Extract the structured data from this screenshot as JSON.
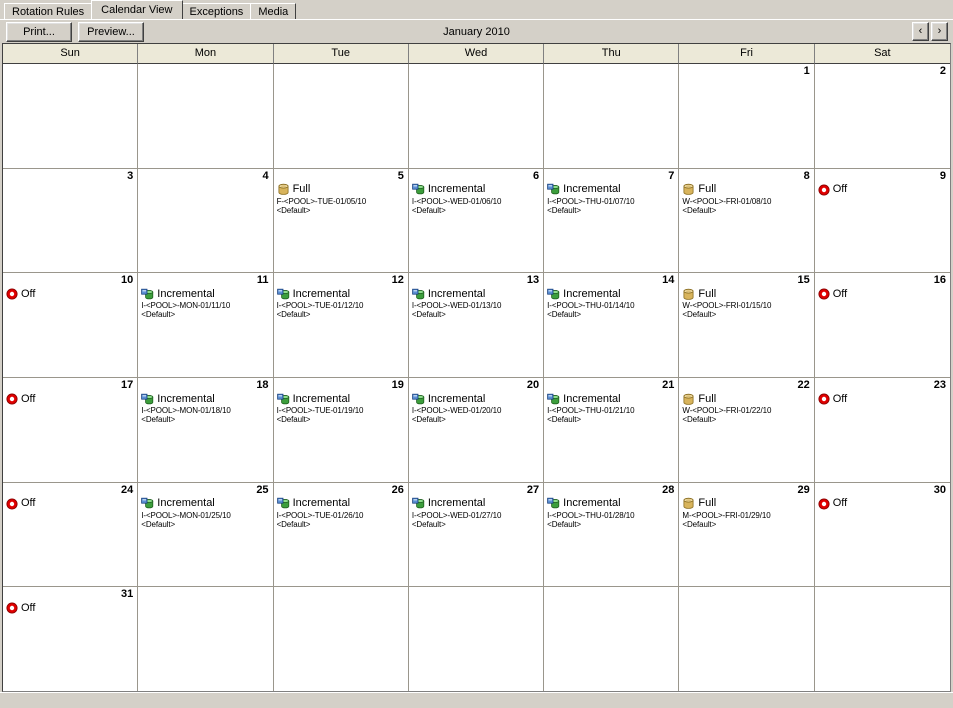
{
  "window": {
    "tabs": [
      {
        "label": "Rotation Rules",
        "selected": false
      },
      {
        "label": "Calendar View",
        "selected": true
      },
      {
        "label": "Exceptions",
        "selected": false
      },
      {
        "label": "Media",
        "selected": false
      }
    ]
  },
  "toolbar": {
    "print_label": "Print...",
    "preview_label": "Preview...",
    "month_title": "January 2010",
    "prev_label": "‹",
    "next_label": "›"
  },
  "calendar": {
    "day_headers": [
      "Sun",
      "Mon",
      "Tue",
      "Wed",
      "Thu",
      "Fri",
      "Sat"
    ],
    "labels": {
      "full": "Full",
      "incremental": "Incremental",
      "off": "Off",
      "default_media": "<Default>"
    },
    "colors": {
      "full_icon": "#d8b45c",
      "incremental_icon": "#3c9e3c",
      "off_icon": "#e00000",
      "header_bg": "#ece9d8",
      "cell_bg": "#ffffff",
      "window_bg": "#d4d0c8",
      "grid_line": "#9a968c"
    },
    "weeks": [
      [
        {
          "day": "",
          "events": []
        },
        {
          "day": "",
          "events": []
        },
        {
          "day": "",
          "events": []
        },
        {
          "day": "",
          "events": []
        },
        {
          "day": "",
          "events": []
        },
        {
          "day": "1",
          "events": []
        },
        {
          "day": "2",
          "events": []
        }
      ],
      [
        {
          "day": "3",
          "events": []
        },
        {
          "day": "4",
          "events": []
        },
        {
          "day": "5",
          "events": [
            {
              "type": "full",
              "title": "Full",
              "job": "F-<POOL>-TUE-01/05/10",
              "media": "<Default>"
            }
          ]
        },
        {
          "day": "6",
          "events": [
            {
              "type": "incremental",
              "title": "Incremental",
              "job": "I-<POOL>-WED-01/06/10",
              "media": "<Default>"
            }
          ]
        },
        {
          "day": "7",
          "events": [
            {
              "type": "incremental",
              "title": "Incremental",
              "job": "I-<POOL>-THU-01/07/10",
              "media": "<Default>"
            }
          ]
        },
        {
          "day": "8",
          "events": [
            {
              "type": "full",
              "title": "Full",
              "job": "W-<POOL>-FRI-01/08/10",
              "media": "<Default>"
            }
          ]
        },
        {
          "day": "9",
          "events": [
            {
              "type": "off",
              "title": "Off",
              "job": "",
              "media": ""
            }
          ]
        }
      ],
      [
        {
          "day": "10",
          "events": [
            {
              "type": "off",
              "title": "Off",
              "job": "",
              "media": ""
            }
          ]
        },
        {
          "day": "11",
          "events": [
            {
              "type": "incremental",
              "title": "Incremental",
              "job": "I-<POOL>-MON-01/11/10",
              "media": "<Default>"
            }
          ]
        },
        {
          "day": "12",
          "events": [
            {
              "type": "incremental",
              "title": "Incremental",
              "job": "I-<POOL>-TUE-01/12/10",
              "media": "<Default>"
            }
          ]
        },
        {
          "day": "13",
          "events": [
            {
              "type": "incremental",
              "title": "Incremental",
              "job": "I-<POOL>-WED-01/13/10",
              "media": "<Default>"
            }
          ]
        },
        {
          "day": "14",
          "events": [
            {
              "type": "incremental",
              "title": "Incremental",
              "job": "I-<POOL>-THU-01/14/10",
              "media": "<Default>"
            }
          ]
        },
        {
          "day": "15",
          "events": [
            {
              "type": "full",
              "title": "Full",
              "job": "W-<POOL>-FRI-01/15/10",
              "media": "<Default>"
            }
          ]
        },
        {
          "day": "16",
          "events": [
            {
              "type": "off",
              "title": "Off",
              "job": "",
              "media": ""
            }
          ]
        }
      ],
      [
        {
          "day": "17",
          "events": [
            {
              "type": "off",
              "title": "Off",
              "job": "",
              "media": ""
            }
          ]
        },
        {
          "day": "18",
          "events": [
            {
              "type": "incremental",
              "title": "Incremental",
              "job": "I-<POOL>-MON-01/18/10",
              "media": "<Default>"
            }
          ]
        },
        {
          "day": "19",
          "events": [
            {
              "type": "incremental",
              "title": "Incremental",
              "job": "I-<POOL>-TUE-01/19/10",
              "media": "<Default>"
            }
          ]
        },
        {
          "day": "20",
          "events": [
            {
              "type": "incremental",
              "title": "Incremental",
              "job": "I-<POOL>-WED-01/20/10",
              "media": "<Default>"
            }
          ]
        },
        {
          "day": "21",
          "events": [
            {
              "type": "incremental",
              "title": "Incremental",
              "job": "I-<POOL>-THU-01/21/10",
              "media": "<Default>"
            }
          ]
        },
        {
          "day": "22",
          "events": [
            {
              "type": "full",
              "title": "Full",
              "job": "W-<POOL>-FRI-01/22/10",
              "media": "<Default>"
            }
          ]
        },
        {
          "day": "23",
          "events": [
            {
              "type": "off",
              "title": "Off",
              "job": "",
              "media": ""
            }
          ]
        }
      ],
      [
        {
          "day": "24",
          "events": [
            {
              "type": "off",
              "title": "Off",
              "job": "",
              "media": ""
            }
          ]
        },
        {
          "day": "25",
          "events": [
            {
              "type": "incremental",
              "title": "Incremental",
              "job": "I-<POOL>-MON-01/25/10",
              "media": "<Default>"
            }
          ]
        },
        {
          "day": "26",
          "events": [
            {
              "type": "incremental",
              "title": "Incremental",
              "job": "I-<POOL>-TUE-01/26/10",
              "media": "<Default>"
            }
          ]
        },
        {
          "day": "27",
          "events": [
            {
              "type": "incremental",
              "title": "Incremental",
              "job": "I-<POOL>-WED-01/27/10",
              "media": "<Default>"
            }
          ]
        },
        {
          "day": "28",
          "events": [
            {
              "type": "incremental",
              "title": "Incremental",
              "job": "I-<POOL>-THU-01/28/10",
              "media": "<Default>"
            }
          ]
        },
        {
          "day": "29",
          "events": [
            {
              "type": "full",
              "title": "Full",
              "job": "M-<POOL>-FRI-01/29/10",
              "media": "<Default>"
            }
          ]
        },
        {
          "day": "30",
          "events": [
            {
              "type": "off",
              "title": "Off",
              "job": "",
              "media": ""
            }
          ]
        }
      ],
      [
        {
          "day": "31",
          "events": [
            {
              "type": "off",
              "title": "Off",
              "job": "",
              "media": ""
            }
          ]
        },
        {
          "day": "",
          "events": []
        },
        {
          "day": "",
          "events": []
        },
        {
          "day": "",
          "events": []
        },
        {
          "day": "",
          "events": []
        },
        {
          "day": "",
          "events": []
        },
        {
          "day": "",
          "events": []
        }
      ]
    ]
  }
}
